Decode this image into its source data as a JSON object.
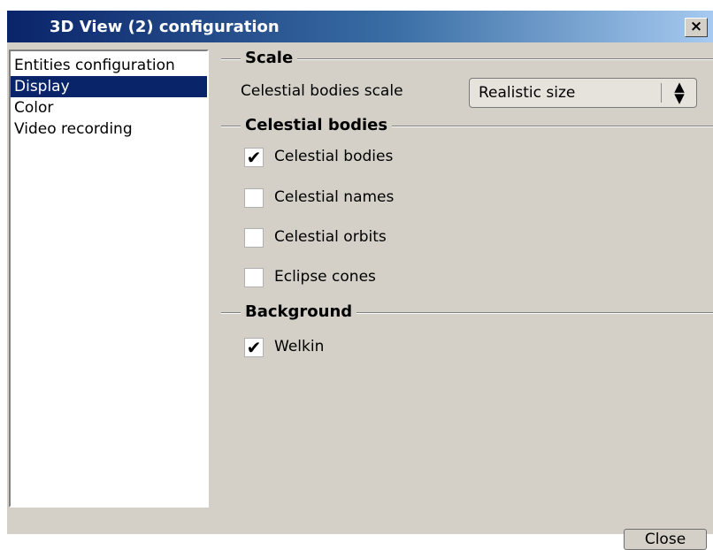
{
  "window": {
    "title": "3D View (2) configuration",
    "close_icon": "×"
  },
  "sidebar": {
    "items": [
      {
        "label": "Entities configuration",
        "selected": false
      },
      {
        "label": "Display",
        "selected": true
      },
      {
        "label": "Color",
        "selected": false
      },
      {
        "label": "Video recording",
        "selected": false
      }
    ]
  },
  "scale": {
    "title": "Scale",
    "celestial_scale_label": "Celestial bodies scale",
    "celestial_scale_value": "Realistic size",
    "combo_arrows_icon": "up-down-arrows"
  },
  "celestial": {
    "title": "Celestial bodies",
    "options": [
      {
        "label": "Celestial bodies",
        "checked": true
      },
      {
        "label": "Celestial names",
        "checked": false
      },
      {
        "label": "Celestial orbits",
        "checked": false
      },
      {
        "label": "Eclipse cones",
        "checked": false
      }
    ]
  },
  "background": {
    "title": "Background",
    "options": [
      {
        "label": "Welkin",
        "checked": true
      }
    ]
  },
  "footer": {
    "close_label": "Close"
  },
  "colors": {
    "titlebar_start": "#0a246a",
    "titlebar_end": "#a6caf0",
    "selection": "#0a246a",
    "face": "#d4d0c8"
  }
}
